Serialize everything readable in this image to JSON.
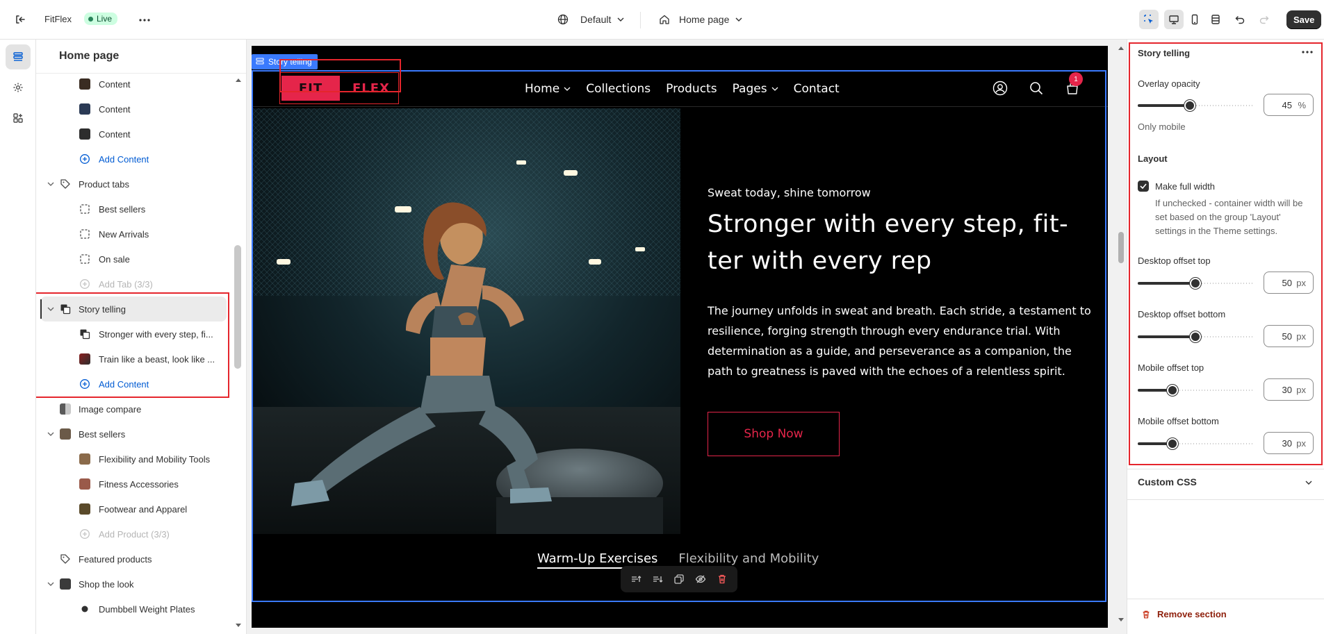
{
  "topbar": {
    "store_name": "FitFlex",
    "status": "Live",
    "theme_select": "Default",
    "page_select": "Home page",
    "save_label": "Save"
  },
  "sidebar": {
    "title": "Home page",
    "items": [
      {
        "label": "Content",
        "type": "block"
      },
      {
        "label": "Content",
        "type": "block"
      },
      {
        "label": "Content",
        "type": "block"
      },
      {
        "label": "Add Content",
        "type": "add"
      },
      {
        "label": "Product tabs",
        "type": "section"
      },
      {
        "label": "Best sellers",
        "type": "block"
      },
      {
        "label": "New Arrivals",
        "type": "block"
      },
      {
        "label": "On sale",
        "type": "block"
      },
      {
        "label": "Add Tab (3/3)",
        "type": "add-disabled"
      },
      {
        "label": "Story telling",
        "type": "section-selected"
      },
      {
        "label": "Stronger with every step, fi...",
        "type": "block"
      },
      {
        "label": "Train like a beast, look like ...",
        "type": "block"
      },
      {
        "label": "Add Content",
        "type": "add"
      },
      {
        "label": "Image compare",
        "type": "section"
      },
      {
        "label": "Best sellers",
        "type": "section"
      },
      {
        "label": "Flexibility and Mobility Tools",
        "type": "block"
      },
      {
        "label": "Fitness Accessories",
        "type": "block"
      },
      {
        "label": "Footwear and Apparel",
        "type": "block"
      },
      {
        "label": "Add Product (3/3)",
        "type": "add-disabled"
      },
      {
        "label": "Featured products",
        "type": "section"
      },
      {
        "label": "Shop the look",
        "type": "section"
      },
      {
        "label": "Dumbbell Weight Plates",
        "type": "block"
      }
    ]
  },
  "preview": {
    "section_tag": "Story telling",
    "logo": {
      "left": "FIT",
      "right": "FLEX"
    },
    "nav": [
      "Home",
      "Collections",
      "Products",
      "Pages",
      "Contact"
    ],
    "cart_count": "1",
    "hero": {
      "subheading": "Sweat today, shine tomorrow",
      "heading": "Stronger with every step, fit-ter with every rep",
      "body": "The journey unfolds in sweat and breath. Each stride, a testament to resilience, forging strength through every endurance trial. With determination as a guide, and perseverance as a companion, the path to greatness is paved with the echoes of a relentless spirit.",
      "button": "Shop Now"
    },
    "tabs": [
      "Warm-Up Exercises",
      "Flexibility and Mobility"
    ]
  },
  "settings": {
    "title": "Story telling",
    "overlay_opacity": {
      "label": "Overlay opacity",
      "value": "45",
      "unit": "%",
      "fraction": 0.45
    },
    "only_mobile": "Only mobile",
    "layout_heading": "Layout",
    "full_width": {
      "label": "Make full width",
      "checked": true,
      "help": "If unchecked - container width will be set based on the group 'Layout' settings in the Theme settings."
    },
    "desktop_top": {
      "label": "Desktop offset top",
      "value": "50",
      "unit": "px",
      "fraction": 0.5
    },
    "desktop_bottom": {
      "label": "Desktop offset bottom",
      "value": "50",
      "unit": "px",
      "fraction": 0.5
    },
    "mobile_top": {
      "label": "Mobile offset top",
      "value": "30",
      "unit": "px",
      "fraction": 0.3
    },
    "mobile_bottom": {
      "label": "Mobile offset bottom",
      "value": "30",
      "unit": "px",
      "fraction": 0.3
    },
    "custom_css": "Custom CSS",
    "remove": "Remove section"
  },
  "colors": {
    "accent": "#e5254a",
    "selection_blue": "#3a7afe",
    "highlight_red": "#e5252c",
    "live_green": "#29845a"
  }
}
